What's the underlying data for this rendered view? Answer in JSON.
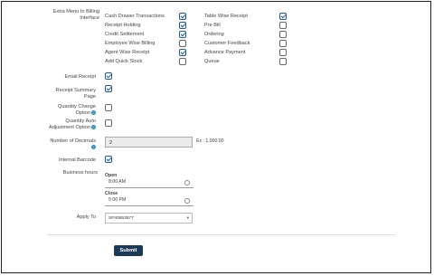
{
  "extra_menu": {
    "label": "Extra Menu In Billing Interface",
    "left_options": [
      {
        "label": "Cash Drawer Transactions",
        "checked": true
      },
      {
        "label": "Receipt Holding",
        "checked": true
      },
      {
        "label": "Credit Settlement",
        "checked": true
      },
      {
        "label": "Employee Wise Billing",
        "checked": false
      },
      {
        "label": "Agent Wise Receipt",
        "checked": true
      },
      {
        "label": "Add Quick Stock",
        "checked": false
      }
    ],
    "right_options": [
      {
        "label": "Table Wise Receipt",
        "checked": true
      },
      {
        "label": "Pre Bill",
        "checked": false
      },
      {
        "label": "Ordering",
        "checked": false
      },
      {
        "label": "Customer Feedback",
        "checked": false
      },
      {
        "label": "Advance Payment",
        "checked": false
      },
      {
        "label": "Queue",
        "checked": false
      }
    ]
  },
  "email_receipt": {
    "label": "Email Receipt",
    "checked": true
  },
  "receipt_summary_page": {
    "label": "Receipt Summary Page",
    "checked": true
  },
  "quantity_change_option": {
    "label": "Quantity Change Option",
    "checked": false
  },
  "quantity_auto_adjustment": {
    "label": "Quantity Auto Adjustment Option",
    "checked": false
  },
  "number_of_decimals": {
    "label": "Number of Decimals",
    "value": "2",
    "example": "Ex : 1,000.00"
  },
  "internal_barcode": {
    "label": "Internal Barcode",
    "checked": true
  },
  "business_hours": {
    "label": "Business hours",
    "open_label": "Open",
    "open_value": "8:00 AM",
    "close_label": "Close",
    "close_value": "5:00 PM"
  },
  "apply_to": {
    "label": "Apply To",
    "value": "SP40653577"
  },
  "submit_label": "Submit",
  "colors": {
    "accent": "#1e5a8e",
    "button": "#1b3a57",
    "help": "#2e86c1"
  }
}
